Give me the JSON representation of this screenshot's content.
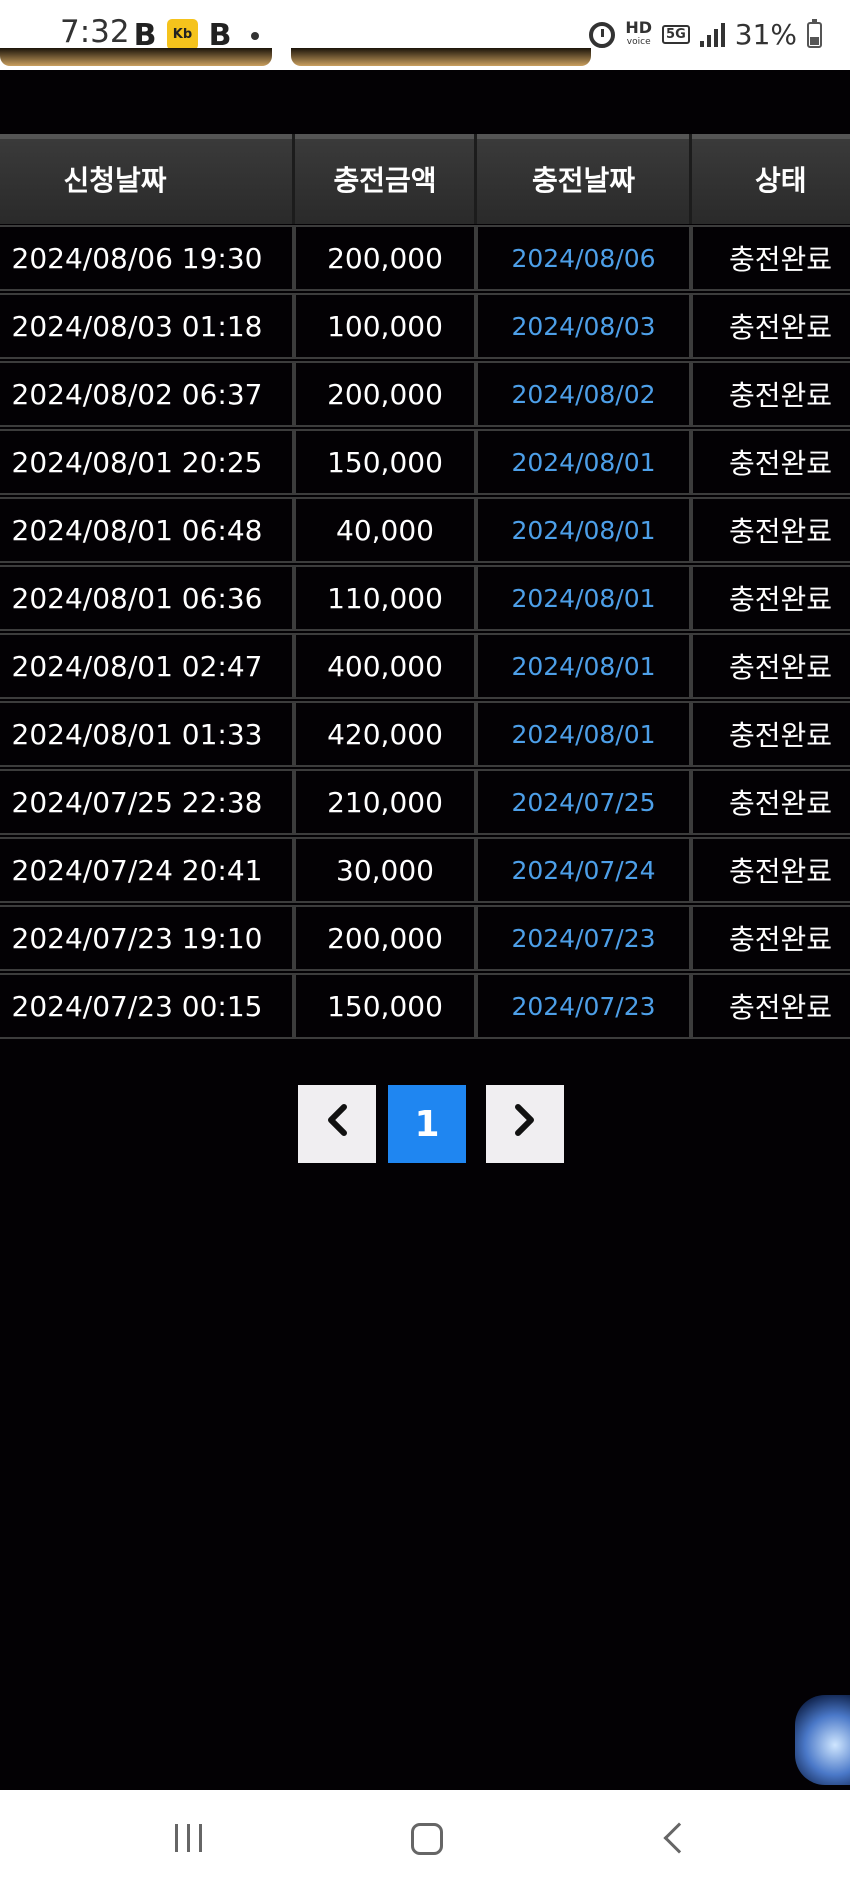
{
  "status_bar": {
    "time": "7:32",
    "app_b1": "B",
    "app_kb": "Kb",
    "app_b2": "B",
    "hd_label": "HD",
    "voice_label": "voice",
    "network_label": "5G",
    "battery_text": "31%"
  },
  "table": {
    "headers": [
      "신청날짜",
      "충전금액",
      "충전날짜",
      "상태"
    ],
    "rows": [
      [
        "2024/08/06 19:30",
        "200,000",
        "2024/08/06",
        "충전완료"
      ],
      [
        "2024/08/03 01:18",
        "100,000",
        "2024/08/03",
        "충전완료"
      ],
      [
        "2024/08/02 06:37",
        "200,000",
        "2024/08/02",
        "충전완료"
      ],
      [
        "2024/08/01 20:25",
        "150,000",
        "2024/08/01",
        "충전완료"
      ],
      [
        "2024/08/01 06:48",
        "40,000",
        "2024/08/01",
        "충전완료"
      ],
      [
        "2024/08/01 06:36",
        "110,000",
        "2024/08/01",
        "충전완료"
      ],
      [
        "2024/08/01 02:47",
        "400,000",
        "2024/08/01",
        "충전완료"
      ],
      [
        "2024/08/01 01:33",
        "420,000",
        "2024/08/01",
        "충전완료"
      ],
      [
        "2024/07/25 22:38",
        "210,000",
        "2024/07/25",
        "충전완료"
      ],
      [
        "2024/07/24 20:41",
        "30,000",
        "2024/07/24",
        "충전완료"
      ],
      [
        "2024/07/23 19:10",
        "200,000",
        "2024/07/23",
        "충전완료"
      ],
      [
        "2024/07/23 00:15",
        "150,000",
        "2024/07/23",
        "충전완료"
      ]
    ]
  },
  "pagination": {
    "prev_icon": "‹",
    "current_page": "1",
    "next_icon": "›"
  },
  "colors": {
    "background": "#030104",
    "date_link": "#4d9fe8",
    "active_page": "#1f86f1",
    "button_gold": "#caa05f"
  }
}
